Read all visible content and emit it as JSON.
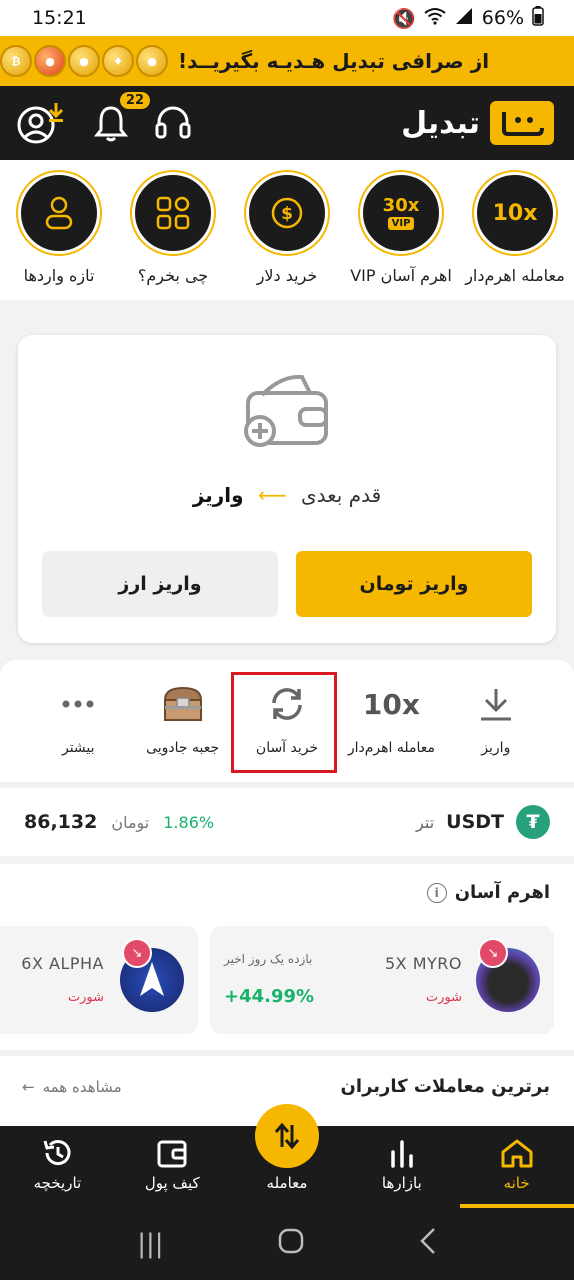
{
  "status_bar": {
    "time": "15:21",
    "battery": "66%"
  },
  "promo_banner": {
    "text": "از صرافی تبدیل هـدیـه بگیریــد!"
  },
  "header": {
    "brand": "تبدیل",
    "notification_count": "22"
  },
  "shortcuts": [
    {
      "label": "معامله اهرم‌دار",
      "icon_text": "10x"
    },
    {
      "label": "اهرم آسان VIP",
      "icon_text": "30x"
    },
    {
      "label": "خرید دلار",
      "icon": "dollar-icon"
    },
    {
      "label": "چی بخرم؟",
      "icon": "shapes-icon"
    },
    {
      "label": "تازه واردها",
      "icon": "person-icon"
    }
  ],
  "deposit_card": {
    "next_step_label": "قدم بعدی",
    "next_step_target": "واریز",
    "primary_button": "واریز تومان",
    "secondary_button": "واریز ارز"
  },
  "quick_actions": [
    {
      "label": "واریز",
      "icon": "download-icon"
    },
    {
      "label": "معامله اهرم‌دار",
      "icon_text": "10x"
    },
    {
      "label": "خرید آسان",
      "icon": "refresh-icon"
    },
    {
      "label": "جعبه جادویی",
      "icon": "chest-icon"
    },
    {
      "label": "بیشتر",
      "icon": "more-icon"
    }
  ],
  "ticker": {
    "symbol": "USDT",
    "name_fa": "تتر",
    "price": "86,132",
    "unit": "تومان",
    "change": "1.86%"
  },
  "easy_leverage": {
    "title": "اهرم آسان",
    "cards": [
      {
        "name": "5X MYRO",
        "side": "شورت",
        "period": "بازده یک روز اخیر",
        "return": "+44.99%"
      },
      {
        "name": "6X ALPHA",
        "side": "شورت"
      }
    ]
  },
  "top_trades": {
    "title": "برترین معاملات کاربران",
    "view_all": "مشاهده همه"
  },
  "tab_bar": {
    "home": "خانه",
    "markets": "بازارها",
    "trade": "معامله",
    "wallet": "کیف پول",
    "history": "تاریخچه"
  },
  "colors": {
    "accent": "#f5b700",
    "dark": "#1b1b1b",
    "positive": "#18b26b",
    "negative": "#e0344f",
    "highlight": "#d71921"
  }
}
